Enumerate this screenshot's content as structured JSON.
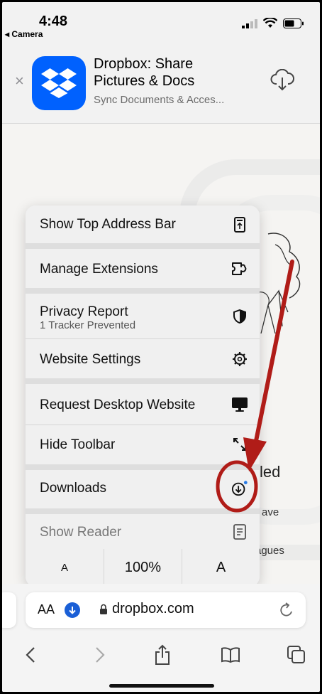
{
  "status": {
    "time": "4:48",
    "back_app": "◂ Camera"
  },
  "banner": {
    "close": "×",
    "app_name": "Dropbox: Share Pictures & Docs",
    "subtitle": "Sync Documents & Acces...",
    "icons": [
      "dropbox-logo",
      "cloud-download-icon"
    ],
    "brand_color": "#0061fe"
  },
  "page_peek": {
    "heading": "led",
    "line1": "ave",
    "line2": "agues"
  },
  "menu": {
    "items": [
      {
        "label": "Show Top Address Bar",
        "icon": "address-bar-top-icon"
      },
      {
        "label": "Manage Extensions",
        "icon": "extensions-icon"
      },
      {
        "label": "Privacy Report",
        "sub": "1 Tracker Prevented",
        "icon": "shield-icon"
      },
      {
        "label": "Website Settings",
        "icon": "gear-icon"
      },
      {
        "label": "Request Desktop Website",
        "icon": "desktop-icon"
      },
      {
        "label": "Hide Toolbar",
        "icon": "expand-arrows-icon"
      },
      {
        "label": "Downloads",
        "icon": "download-circle-icon"
      },
      {
        "label": "Show Reader",
        "icon": "reader-icon"
      }
    ],
    "font_row": {
      "smaller": "A",
      "zoom": "100%",
      "larger": "A"
    }
  },
  "address_bar": {
    "aa": "AA",
    "url": "dropbox.com"
  },
  "toolbar": {
    "icons": [
      "back-icon",
      "forward-icon",
      "share-icon",
      "bookmarks-icon",
      "tabs-icon"
    ]
  },
  "annotation_color": "#b01c18"
}
